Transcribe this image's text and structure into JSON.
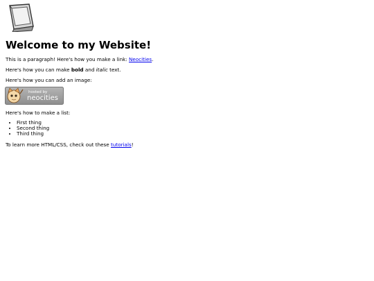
{
  "heading": "Welcome to my Website!",
  "paragraph_link": {
    "before": "This is a paragraph! Here's how you make a link: ",
    "link_text": "Neocities",
    "after": "."
  },
  "paragraph_format": {
    "before": "Here's how you can make ",
    "bold": "bold",
    "middle": " and ",
    "italic": "italic",
    "after": " text."
  },
  "image_intro": "Here's how you can add an image:",
  "badge": {
    "small_text": "hosted by",
    "brand_text": "neocities"
  },
  "list_intro": "Here's how to make a list:",
  "list_items": [
    "First thing",
    "Second thing",
    "Third thing"
  ],
  "tutorial": {
    "before": "To learn more HTML/CSS, check out these ",
    "link_text": "tutorials",
    "after": "!"
  }
}
